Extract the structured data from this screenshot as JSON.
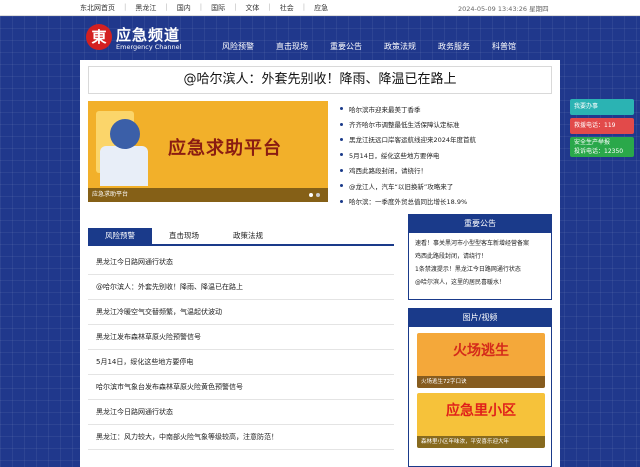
{
  "topbar": {
    "links": [
      "东北网首页",
      "黑龙江",
      "国内",
      "国际",
      "文体",
      "社会",
      "应急"
    ],
    "date": "2024-05-09 13:43:26 星期四"
  },
  "header": {
    "logo_mark": "東",
    "logo_name": "应急频道",
    "logo_en": "Emergency Channel",
    "nav": [
      "风险预警",
      "直击现场",
      "重要公告",
      "政策法规",
      "政务服务",
      "科普馆"
    ]
  },
  "headline": "@哈尔滨人：外套先别收！降雨、降温已在路上",
  "slide": {
    "title": "应急求助平台",
    "caption": "应急求助平台"
  },
  "news": [
    "哈尔滨市迎来最美丁香季",
    "齐齐哈尔市调整最低生活保障认定标准",
    "黑龙江抚远口岸客运航线迎来2024年度首航",
    "5月14日，绥化这些地方要停电",
    "鸡西此路段封闭，请绕行！",
    "@龙江人，汽车“以旧换新”攻略来了",
    "哈尔滨：一季度外贸总值同比增长18.9%"
  ],
  "tabs": [
    "风险预警",
    "直击现场",
    "政策法规"
  ],
  "list": [
    "黑龙江今日路网通行状态",
    "@哈尔滨人：外套先别收！降雨、降温已在路上",
    "黑龙江冷暖空气交替频繁，气温起伏波动",
    "黑龙江发布森林草原火险预警信号",
    "5月14日，绥化这些地方要停电",
    "哈尔滨市气象台发布森林草原火险黄色预警信号",
    "黑龙江今日路网通行状态",
    "黑龙江：风力较大，中南部火险气象等级较高，注意防范！"
  ],
  "notice": {
    "title": "重要公告",
    "items": [
      "速看！事关黑河市小型型客车新增经营备案",
      "鸡西此路段封闭，请绕行！",
      "1条禁渡提示！黑龙江今日路网通行状态",
      "@哈尔滨人，这里的居民喜暖水！"
    ]
  },
  "video": {
    "title": "图片/视频",
    "pics": [
      {
        "title": "火场逃生",
        "caption": "火场逃生72字口诀"
      },
      {
        "title": "应急里小区",
        "caption": "森林里小区年味浓，平安喜乐迎大年"
      }
    ]
  },
  "float": {
    "f1": "我要办事",
    "f2": "救援电话：119",
    "f3a": "安全生产举报",
    "f3b": "投诉电话：12350"
  }
}
